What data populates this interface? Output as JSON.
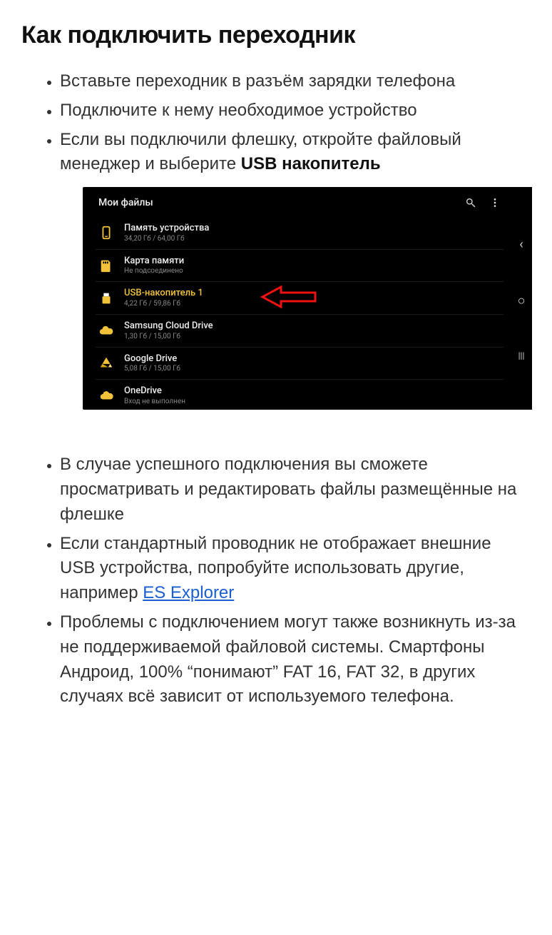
{
  "title": "Как подключить переходник",
  "steps_top": [
    {
      "text": "Вставьте переходник в разъём зарядки телефона"
    },
    {
      "text": "Подключите к нему необходимое устройство"
    },
    {
      "text": "Если вы подключили флешку, откройте файловый менеджер и выберите ",
      "bold_tail": "USB накопитель"
    }
  ],
  "steps_bottom": [
    {
      "text": "В случае успешного подключения вы сможете просматривать и редактировать файлы размещённые на флешке"
    },
    {
      "text": "Если стандартный проводник не отображает внешние USB устройства, попробуйте использовать другие, например ",
      "link_text": "ES Explorer"
    },
    {
      "text": "Проблемы с подключением могут также возникнуть из-за не поддерживаемой файловой системы. Смартфоны Андроид, 100% “понимают” FAT 16, FAT 32, в других случаях всё зависит от используемого телефона."
    }
  ],
  "screenshot": {
    "header_title": "Мои файлы",
    "rows": [
      {
        "icon": "phone",
        "title": "Память устройства",
        "sub": "34,20 Гб / 64,00 Гб"
      },
      {
        "icon": "sd",
        "title": "Карта памяти",
        "sub": "Не подсоединено"
      },
      {
        "icon": "usb",
        "title": "USB-накопитель 1",
        "sub": "4,22 Гб / 59,86 Гб",
        "highlight": true
      },
      {
        "icon": "cloud",
        "title": "Samsung Cloud Drive",
        "sub": "1,30 Гб / 15,00 Гб"
      },
      {
        "icon": "gdrive",
        "title": "Google Drive",
        "sub": "5,08 Гб / 15,00 Гб"
      },
      {
        "icon": "onedrive",
        "title": "OneDrive",
        "sub": "Вход не выполнен"
      }
    ]
  }
}
